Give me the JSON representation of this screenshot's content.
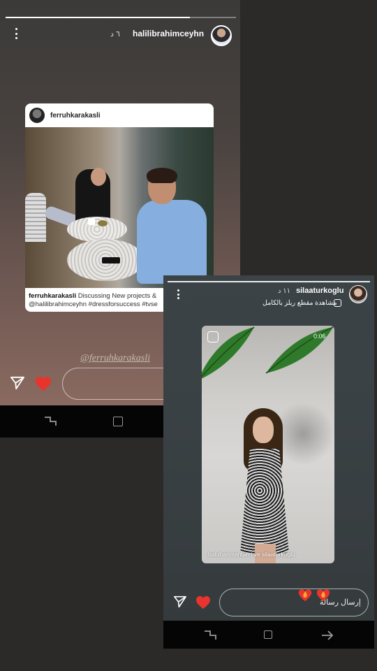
{
  "story1": {
    "username": "halilibrahimceyhn",
    "time": "٦ د",
    "post": {
      "username": "ferruhkarakasli",
      "caption_user": "ferruhkarakasli",
      "caption_text": " Discussing New projects &",
      "caption_line2": "@halilibrahimceyhn #dressforsuccess #tvse"
    },
    "mention": "@ferruhkarakasli"
  },
  "story2": {
    "username": "silaaturkoglu",
    "time": "١١ د",
    "reels_link": "مشاهدة مقطع ريلز بالكامل",
    "reel": {
      "duration": "0:06",
      "credit": "batuhanmantarci ve silaaturkoglu"
    },
    "reply_placeholder": "إرسال رسالة",
    "emoji_name": "heart-on-fire"
  },
  "colors": {
    "heart": "#e8342c",
    "navbar": "#050505"
  },
  "icons": [
    "menu-dots-icon",
    "send-icon",
    "heart-icon",
    "reels-icon",
    "nav-back-icon",
    "nav-home-icon",
    "nav-recent-icon"
  ]
}
